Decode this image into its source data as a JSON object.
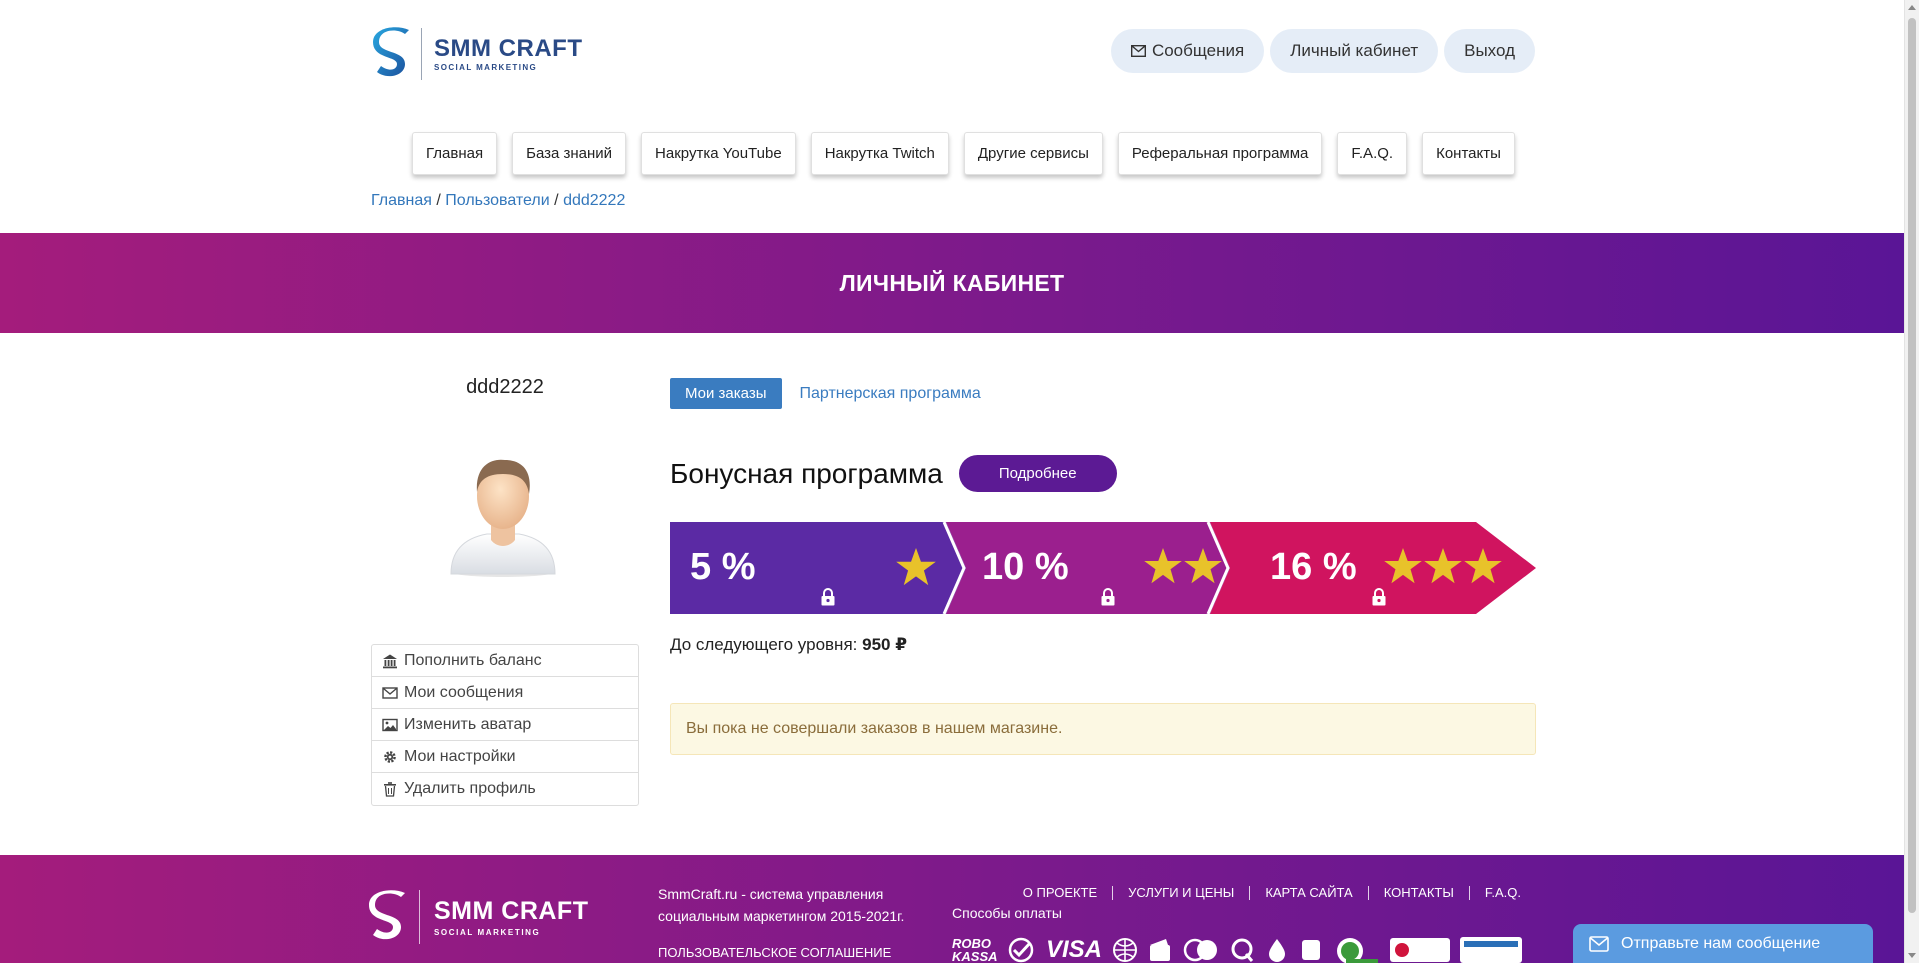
{
  "header": {
    "brand": "SMM CRAFT",
    "tagline": "SOCIAL MARKETING",
    "actions": [
      {
        "label": "Сообщения",
        "icon": "envelope-icon"
      },
      {
        "label": "Личный кабинет"
      },
      {
        "label": "Выход"
      }
    ]
  },
  "nav": [
    "Главная",
    "База знаний",
    "Накрутка YouTube",
    "Накрутка Twitch",
    "Другие сервисы",
    "Реферальная программа",
    "F.A.Q.",
    "Контакты"
  ],
  "breadcrumb": {
    "items": [
      "Главная",
      "Пользователи",
      "ddd2222"
    ],
    "separator": "/"
  },
  "banner": {
    "title": "ЛИЧНЫЙ КАБИНЕТ"
  },
  "sidebar": {
    "username": "ddd2222",
    "menu": [
      {
        "label": "Пополнить баланс",
        "icon": "bank-icon"
      },
      {
        "label": "Мои сообщения",
        "icon": "envelope-icon"
      },
      {
        "label": "Изменить аватар",
        "icon": "image-icon"
      },
      {
        "label": "Мои настройки",
        "icon": "gear-icon"
      },
      {
        "label": "Удалить профиль",
        "icon": "trash-icon"
      }
    ]
  },
  "tabs": [
    {
      "label": "Мои заказы",
      "active": true
    },
    {
      "label": "Партнерская программа",
      "active": false
    }
  ],
  "bonus": {
    "title": "Бонусная программа",
    "more_label": "Подробнее",
    "levels": [
      {
        "percent": "5 %",
        "stars": 1,
        "locked": true,
        "color": "#5b2aa4"
      },
      {
        "percent": "10 %",
        "stars": 2,
        "locked": true,
        "color": "#9b1f8e"
      },
      {
        "percent": "16 %",
        "stars": 3,
        "locked": true,
        "color": "#d0145f"
      }
    ],
    "next_level_label": "До следующего уровня:",
    "next_level_value": "950 ₽"
  },
  "alert": {
    "text": "Вы пока не совершали заказов в нашем магазине."
  },
  "footer": {
    "brand": "SMM CRAFT",
    "tagline": "SOCIAL MARKETING",
    "description": "SmmCraft.ru - система управления социальным маркетингом 2015-2021г.",
    "agreement": "ПОЛЬЗОВАТЕЛЬСКОЕ СОГЛАШЕНИЕ",
    "links": [
      "О ПРОЕКТЕ",
      "УСЛУГИ И ЦЕНЫ",
      "КАРТА САЙТА",
      "КОНТАКТЫ",
      "F.A.Q."
    ],
    "payment_label": "Способы оплаты",
    "payment_methods": [
      "ROBO KASSA",
      "VISA"
    ]
  },
  "chat": {
    "label": "Отправьте нам сообщение"
  },
  "colors": {
    "accent": "#3a7cc0",
    "brand_purple": "#5c1a94",
    "banner_start": "#a41c7c",
    "banner_end": "#5a1596",
    "star": "#e8c22a"
  }
}
